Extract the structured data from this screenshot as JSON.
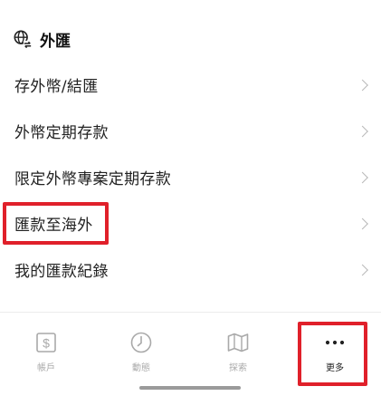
{
  "section": {
    "title": "外匯",
    "icon": "globe-exchange-icon"
  },
  "menu": [
    {
      "label": "存外幣/結匯"
    },
    {
      "label": "外幣定期存款"
    },
    {
      "label": "限定外幣專案定期存款"
    },
    {
      "label": "匯款至海外",
      "highlighted": true
    },
    {
      "label": "我的匯款紀錄"
    }
  ],
  "tabbar": {
    "account": {
      "label": "帳戶",
      "icon": "dollar-card-icon"
    },
    "activity": {
      "label": "動態",
      "icon": "clock-icon"
    },
    "explore": {
      "label": "探索",
      "icon": "map-icon"
    },
    "more": {
      "label": "更多",
      "icon": "more-dots-icon",
      "active": true
    }
  },
  "colors": {
    "highlight": "#e0202a",
    "inactive": "#a9a9a9",
    "active": "#222222"
  }
}
